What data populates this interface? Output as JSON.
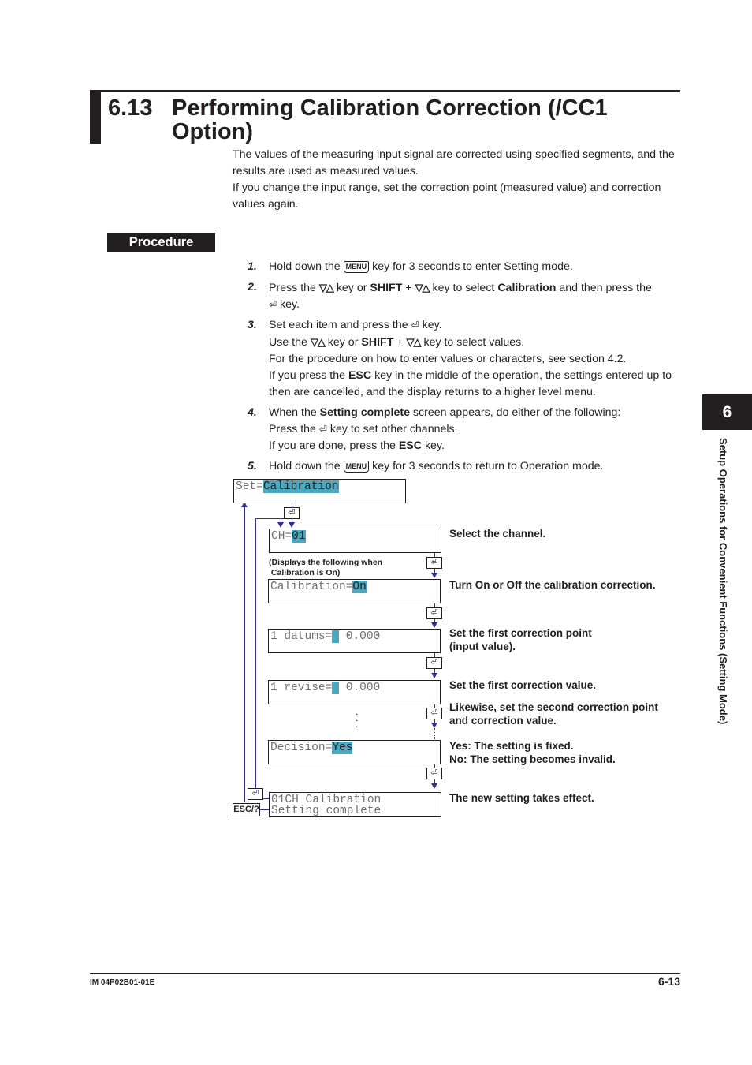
{
  "section": {
    "number": "6.13",
    "title": "Performing Calibration Correction (/CC1 Option)"
  },
  "intro": [
    "The values of the measuring input signal are corrected using specified segments, and the results are used as measured values.",
    "If you change the input range, set the correction point (measured value) and correction values again."
  ],
  "procedure_label": "Procedure",
  "keys": {
    "menu": "MENU",
    "arrows": "▽△",
    "enter": "⏎",
    "shift": "SHIFT",
    "esc": "ESC"
  },
  "steps": [
    {
      "num": "1.",
      "lines": [
        {
          "pre": "Hold down the ",
          "key": "MENU",
          "post": " key for 3 seconds to enter Setting mode."
        }
      ]
    },
    {
      "num": "2.",
      "text_a": "Press the ",
      "text_b": " key or ",
      "bold_a": "SHIFT",
      "text_c": " + ",
      "text_d": " key to select ",
      "bold_b": "Calibration",
      "text_e": " and then press the",
      "text_f": " key."
    },
    {
      "num": "3.",
      "l1a": "Set each item and press the ",
      "l1b": " key.",
      "l2a": "Use the ",
      "l2b": " key or ",
      "l2bold": "SHIFT",
      "l2c": " + ",
      "l2d": " key to select values.",
      "l3": "For the procedure on how to enter values or characters, see section 4.2.",
      "l4a": "If you press the ",
      "l4bold": "ESC",
      "l4b": " key in the middle of the operation, the settings entered up to then are cancelled, and the display returns to a higher level menu."
    },
    {
      "num": "4.",
      "l1a": "When the ",
      "l1bold": "Setting complete",
      "l1b": " screen appears, do either of the following:",
      "l2a": "Press the ",
      "l2b": " key to set other channels.",
      "l3a": "If you are done, press the ",
      "l3bold": "ESC",
      "l3b": " key."
    },
    {
      "num": "5.",
      "pre": "Hold down the ",
      "key": "MENU",
      "post": " key for 3 seconds to return to Operation mode."
    }
  ],
  "flow": {
    "screens": [
      {
        "prefix": "Set=",
        "value": "Calibration",
        "suffix": ""
      },
      {
        "prefix": "CH=",
        "value": "01",
        "suffix": ""
      },
      {
        "prefix": "Calibration=",
        "value": "On",
        "suffix": ""
      },
      {
        "prefix": "1 datums=",
        "value": " ",
        "suffix": " 0.000"
      },
      {
        "prefix": "1 revise=",
        "value": " ",
        "suffix": " 0.000"
      },
      {
        "prefix": "Decision=",
        "value": "Yes",
        "suffix": ""
      },
      {
        "line1": "01CH Calibration",
        "line2": "Setting complete"
      }
    ],
    "note": "(Displays the following when\n Calibration is On)",
    "descriptions": [
      "Select the channel.",
      "Turn On or Off the calibration correction.",
      "Set the first correction point\n(input value).",
      "Set the first correction value.",
      "Likewise, set the second correction point\nand correction value.",
      "Yes: The setting is fixed.\nNo: The setting becomes invalid.",
      "The new setting takes effect."
    ],
    "esc_label": "ESC/?",
    "ellipsis": ".\n.\n."
  },
  "side_tab": {
    "chapter": "6",
    "title": "Setup Operations for Convenient Functions (Setting Mode)"
  },
  "footer": {
    "doc_id": "IM 04P02B01-01E",
    "page": "6-13"
  }
}
